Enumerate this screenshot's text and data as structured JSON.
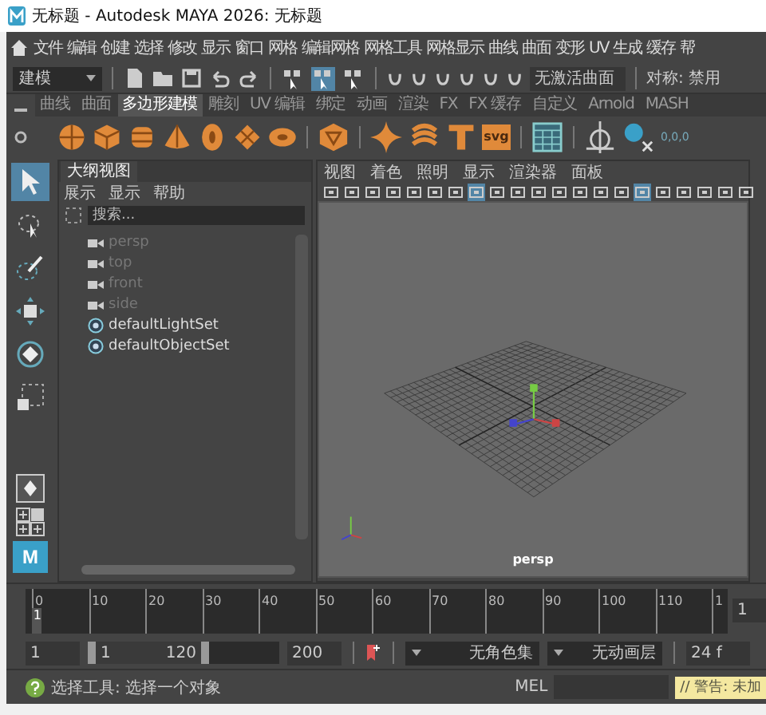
{
  "window": {
    "title": "无标题 - Autodesk MAYA 2026: 无标题"
  },
  "menu_bar": [
    "文件",
    "编辑",
    "创建",
    "选择",
    "修改",
    "显示",
    "窗口",
    "网格",
    "编辑网格",
    "网格工具",
    "网格显示",
    "曲线",
    "曲面",
    "变形",
    "UV",
    "生成",
    "缓存",
    "帮"
  ],
  "status_line": {
    "menu_set": "建模",
    "selection_modes": [
      {
        "selected": false
      },
      {
        "selected": true
      },
      {
        "selected": false
      }
    ],
    "live_surface": "无激活曲面",
    "symmetry": "对称: 禁用"
  },
  "shelf": {
    "tabs": [
      {
        "label": "曲线",
        "selected": false
      },
      {
        "label": "曲面",
        "selected": false
      },
      {
        "label": "多边形建模",
        "selected": true
      },
      {
        "label": "雕刻",
        "selected": false
      },
      {
        "label": "UV 编辑",
        "selected": false
      },
      {
        "label": "绑定",
        "selected": false
      },
      {
        "label": "动画",
        "selected": false
      },
      {
        "label": "渲染",
        "selected": false
      },
      {
        "label": "FX",
        "selected": false
      },
      {
        "label": "FX 缓存",
        "selected": false
      },
      {
        "label": "自定义",
        "selected": false
      },
      {
        "label": "Arnold",
        "selected": false
      },
      {
        "label": "MASH",
        "selected": false
      }
    ],
    "svg_label": "svg",
    "coords_label": "0,0,0"
  },
  "toolbox": {
    "tools": [
      {
        "kind": "select",
        "selected": true
      },
      {
        "kind": "lasso",
        "selected": false
      },
      {
        "kind": "paint",
        "selected": false
      },
      {
        "kind": "move",
        "selected": false
      },
      {
        "kind": "rotate",
        "selected": false
      },
      {
        "kind": "scale",
        "selected": false
      }
    ],
    "maya_button": "M"
  },
  "outliner": {
    "tab": "大纲视图",
    "menu": [
      "展示",
      "显示",
      "帮助"
    ],
    "search": {
      "placeholder": "搜索..."
    },
    "items": [
      {
        "label": "persp",
        "kind": "camera",
        "dimmed": true
      },
      {
        "label": "top",
        "kind": "camera",
        "dimmed": true
      },
      {
        "label": "front",
        "kind": "camera",
        "dimmed": true
      },
      {
        "label": "side",
        "kind": "camera",
        "dimmed": true
      },
      {
        "label": "defaultLightSet",
        "kind": "set",
        "dimmed": false
      },
      {
        "label": "defaultObjectSet",
        "kind": "set",
        "dimmed": false
      }
    ]
  },
  "viewport": {
    "menu": [
      "视图",
      "着色",
      "照明",
      "显示",
      "渲染器",
      "面板"
    ],
    "toolbar": [
      {
        "selected": false
      },
      {
        "selected": false
      },
      {
        "selected": false
      },
      {
        "selected": false
      },
      {
        "selected": false
      },
      {
        "selected": false
      },
      {
        "selected": false
      },
      {
        "selected": true
      },
      {
        "selected": false
      },
      {
        "selected": false
      },
      {
        "selected": false
      },
      {
        "selected": false
      },
      {
        "selected": false
      },
      {
        "selected": false
      },
      {
        "selected": false
      },
      {
        "selected": true
      },
      {
        "selected": false
      },
      {
        "selected": false
      },
      {
        "selected": false
      },
      {
        "selected": false
      },
      {
        "selected": false
      }
    ],
    "camera_label": "persp"
  },
  "time_slider": {
    "ticks": [
      "0",
      "10",
      "20",
      "30",
      "40",
      "50",
      "60",
      "70",
      "80",
      "90",
      "100",
      "110",
      "1"
    ],
    "current_frame": "1",
    "level": 0.008,
    "frame_field": "1"
  },
  "range_slider": {
    "start": "1",
    "range_start": "1",
    "range_end": "120",
    "level": 0.6,
    "end": "200",
    "character_set": "无角色集",
    "anim_layer": "无动画层",
    "fps": "24 f"
  },
  "help_line": {
    "message": "选择工具: 选择一个对象",
    "script_type": "MEL",
    "warning": "// 警告: 未加"
  }
}
